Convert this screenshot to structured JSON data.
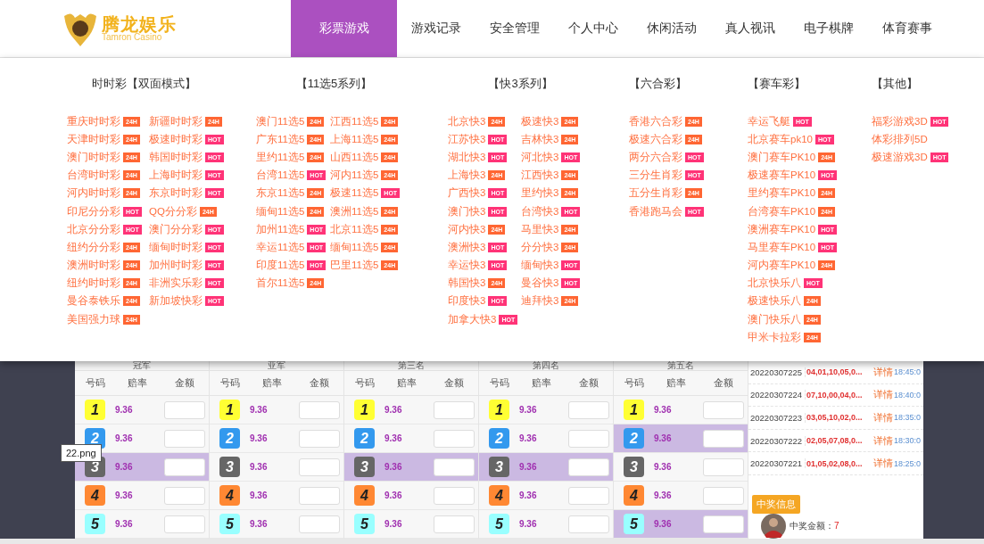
{
  "header": {
    "logo_title": "腾龙娱乐",
    "logo_subtitle": "Tamron Casino"
  },
  "nav": [
    {
      "label": "彩票游戏",
      "selected": true
    },
    {
      "label": "游戏记录",
      "selected": false
    },
    {
      "label": "安全管理",
      "selected": false
    },
    {
      "label": "个人中心",
      "selected": false
    },
    {
      "label": "休闲活动",
      "selected": false
    },
    {
      "label": "真人视讯",
      "selected": false
    },
    {
      "label": "电子棋牌",
      "selected": false
    },
    {
      "label": "体育赛事",
      "selected": false
    }
  ],
  "menu": [
    {
      "title": "时时彩【双面模式】",
      "columns": [
        [
          {
            "name": "重庆时时彩",
            "badge": "24H",
            "color": "#ff6633"
          },
          {
            "name": "天津时时彩",
            "badge": "24H",
            "color": "#ff6633"
          },
          {
            "name": "澳门时时彩",
            "badge": "24H",
            "color": "#ff6633"
          },
          {
            "name": "台湾时时彩",
            "badge": "24H",
            "color": "#ff6633"
          },
          {
            "name": "河内时时彩",
            "badge": "24H",
            "color": "#ff6633"
          },
          {
            "name": "印尼分分彩",
            "badge": "HOT",
            "color": "#ff3377"
          },
          {
            "name": "北京分分彩",
            "badge": "HOT",
            "color": "#ff3377"
          },
          {
            "name": "纽约分分彩",
            "badge": "24H",
            "color": "#ff6633"
          },
          {
            "name": "澳洲时时彩",
            "badge": "24H",
            "color": "#ff6633"
          },
          {
            "name": "纽约时时彩",
            "badge": "24H",
            "color": "#ff6633"
          },
          {
            "name": "曼谷泰铁乐",
            "badge": "24H",
            "color": "#ff6633"
          },
          {
            "name": "美国强力球",
            "badge": "24H",
            "color": "#ff6633"
          }
        ],
        [
          {
            "name": "新疆时时彩",
            "badge": "24H",
            "color": "#ff6633"
          },
          {
            "name": "极速时时彩",
            "badge": "HOT",
            "color": "#ff3377"
          },
          {
            "name": "韩国时时彩",
            "badge": "HOT",
            "color": "#ff3377"
          },
          {
            "name": "上海时时彩",
            "badge": "HOT",
            "color": "#ff3377"
          },
          {
            "name": "东京时时彩",
            "badge": "HOT",
            "color": "#ff3377"
          },
          {
            "name": "QQ分分彩",
            "badge": "24H",
            "color": "#ff6633"
          },
          {
            "name": "澳门分分彩",
            "badge": "HOT",
            "color": "#ff3377"
          },
          {
            "name": "缅甸时时彩",
            "badge": "HOT",
            "color": "#ff3377"
          },
          {
            "name": "加州时时彩",
            "badge": "HOT",
            "color": "#ff3377"
          },
          {
            "name": "非洲实乐彩",
            "badge": "HOT",
            "color": "#ff3377"
          },
          {
            "name": "新加坡快彩",
            "badge": "HOT",
            "color": "#ff3377"
          }
        ]
      ]
    },
    {
      "title": "【11选5系列】",
      "columns": [
        [
          {
            "name": "澳门11选5",
            "badge": "24H",
            "color": "#ff6633"
          },
          {
            "name": "广东11选5",
            "badge": "24H",
            "color": "#ff6633"
          },
          {
            "name": "里约11选5",
            "badge": "24H",
            "color": "#ff6633"
          },
          {
            "name": "台湾11选5",
            "badge": "HOT",
            "color": "#ff3377"
          },
          {
            "name": "东京11选5",
            "badge": "24H",
            "color": "#ff6633"
          },
          {
            "name": "缅甸11选5",
            "badge": "24H",
            "color": "#ff6633"
          },
          {
            "name": "加州11选5",
            "badge": "HOT",
            "color": "#ff3377"
          },
          {
            "name": "幸运11选5",
            "badge": "HOT",
            "color": "#ff3377"
          },
          {
            "name": "印度11选5",
            "badge": "HOT",
            "color": "#ff3377"
          },
          {
            "name": "首尔11选5",
            "badge": "24H",
            "color": "#ff6633"
          }
        ],
        [
          {
            "name": "江西11选5",
            "badge": "24H",
            "color": "#ff6633"
          },
          {
            "name": "上海11选5",
            "badge": "24H",
            "color": "#ff6633"
          },
          {
            "name": "山西11选5",
            "badge": "24H",
            "color": "#ff6633"
          },
          {
            "name": "河内11选5",
            "badge": "24H",
            "color": "#ff6633"
          },
          {
            "name": "极速11选5",
            "badge": "HOT",
            "color": "#ff3377"
          },
          {
            "name": "澳洲11选5",
            "badge": "24H",
            "color": "#ff6633"
          },
          {
            "name": "北京11选5",
            "badge": "24H",
            "color": "#ff6633"
          },
          {
            "name": "缅甸11选5",
            "badge": "24H",
            "color": "#ff6633"
          },
          {
            "name": "巴里11选5",
            "badge": "24H",
            "color": "#ff6633"
          }
        ]
      ]
    },
    {
      "title": "【快3系列】",
      "columns": [
        [
          {
            "name": "北京快3",
            "badge": "24H",
            "color": "#ff6633"
          },
          {
            "name": "江苏快3",
            "badge": "HOT",
            "color": "#ff3377"
          },
          {
            "name": "湖北快3",
            "badge": "HOT",
            "color": "#ff3377"
          },
          {
            "name": "上海快3",
            "badge": "24H",
            "color": "#ff6633"
          },
          {
            "name": "广西快3",
            "badge": "HOT",
            "color": "#ff3377"
          },
          {
            "name": "澳门快3",
            "badge": "HOT",
            "color": "#ff3377"
          },
          {
            "name": "河内快3",
            "badge": "24H",
            "color": "#ff6633"
          },
          {
            "name": "澳洲快3",
            "badge": "HOT",
            "color": "#ff3377"
          },
          {
            "name": "幸运快3",
            "badge": "HOT",
            "color": "#ff3377"
          },
          {
            "name": "韩国快3",
            "badge": "24H",
            "color": "#ff6633"
          },
          {
            "name": "印度快3",
            "badge": "HOT",
            "color": "#ff3377"
          },
          {
            "name": "加拿大快3",
            "badge": "HOT",
            "color": "#ff3377"
          }
        ],
        [
          {
            "name": "极速快3",
            "badge": "24H",
            "color": "#ff6633"
          },
          {
            "name": "吉林快3",
            "badge": "24H",
            "color": "#ff6633"
          },
          {
            "name": "河北快3",
            "badge": "HOT",
            "color": "#ff3377"
          },
          {
            "name": "江西快3",
            "badge": "24H",
            "color": "#ff6633"
          },
          {
            "name": "里约快3",
            "badge": "24H",
            "color": "#ff6633"
          },
          {
            "name": "台湾快3",
            "badge": "HOT",
            "color": "#ff3377"
          },
          {
            "name": "马里快3",
            "badge": "24H",
            "color": "#ff6633"
          },
          {
            "name": "分分快3",
            "badge": "24H",
            "color": "#ff6633"
          },
          {
            "name": "缅甸快3",
            "badge": "HOT",
            "color": "#ff3377"
          },
          {
            "name": "曼谷快3",
            "badge": "HOT",
            "color": "#ff3377"
          },
          {
            "name": "迪拜快3",
            "badge": "24H",
            "color": "#ff6633"
          }
        ]
      ]
    },
    {
      "title": "【六合彩】",
      "columns": [
        [
          {
            "name": "香港六合彩",
            "badge": "24H",
            "color": "#ff6633"
          },
          {
            "name": "极速六合彩",
            "badge": "24H",
            "color": "#ff6633"
          },
          {
            "name": "两分六合彩",
            "badge": "HOT",
            "color": "#ff3377"
          },
          {
            "name": "三分生肖彩",
            "badge": "HOT",
            "color": "#ff3377"
          },
          {
            "name": "五分生肖彩",
            "badge": "24H",
            "color": "#ff6633"
          },
          {
            "name": "香港跑马会",
            "badge": "HOT",
            "color": "#ff3377"
          }
        ]
      ]
    },
    {
      "title": "【赛车彩】",
      "columns": [
        [
          {
            "name": "幸运飞艇",
            "badge": "HOT",
            "color": "#ff3377"
          },
          {
            "name": "北京赛车pk10",
            "badge": "HOT",
            "color": "#ff3377"
          },
          {
            "name": "澳门赛车PK10",
            "badge": "24H",
            "color": "#ff6633"
          },
          {
            "name": "极速赛车PK10",
            "badge": "HOT",
            "color": "#ff3377"
          },
          {
            "name": "里约赛车PK10",
            "badge": "24H",
            "color": "#ff6633"
          },
          {
            "name": "台湾赛车PK10",
            "badge": "24H",
            "color": "#ff6633"
          },
          {
            "name": "澳洲赛车PK10",
            "badge": "HOT",
            "color": "#ff3377"
          },
          {
            "name": "马里赛车PK10",
            "badge": "HOT",
            "color": "#ff3377"
          },
          {
            "name": "河内赛车PK10",
            "badge": "24H",
            "color": "#ff6633"
          },
          {
            "name": "北京快乐八",
            "badge": "HOT",
            "color": "#ff3377"
          },
          {
            "name": "极速快乐八",
            "badge": "24H",
            "color": "#ff6633"
          },
          {
            "name": "澳门快乐八",
            "badge": "24H",
            "color": "#ff6633"
          },
          {
            "name": "甲米卡拉彩",
            "badge": "24H",
            "color": "#ff6633"
          }
        ]
      ]
    },
    {
      "title": "【其他】",
      "columns": [
        [
          {
            "name": "福彩游戏3D",
            "badge": "HOT",
            "color": "#ff3377"
          },
          {
            "name": "体彩排列5D"
          },
          {
            "name": "极速游戏3D",
            "badge": "HOT",
            "color": "#ff3377"
          }
        ]
      ]
    }
  ],
  "table": {
    "groups": [
      {
        "title": "冠军",
        "columns": [
          "号码",
          "赔率",
          "金额"
        ],
        "rows": [
          {
            "number": "1",
            "color": "#ffff33",
            "odds": "9.36",
            "selected": false
          },
          {
            "number": "2",
            "color": "#3399ee",
            "odds": "9.36",
            "selected": false
          },
          {
            "number": "3",
            "color": "#666666",
            "odds": "9.36",
            "selected": true
          },
          {
            "number": "4",
            "color": "#ff8833",
            "odds": "9.36",
            "selected": false
          },
          {
            "number": "5",
            "color": "#99ffff",
            "odds": "9.36",
            "selected": false
          }
        ]
      },
      {
        "title": "亚军",
        "columns": [
          "号码",
          "赔率",
          "金额"
        ],
        "rows": [
          {
            "number": "1",
            "color": "#ffff33",
            "odds": "9.36",
            "selected": false
          },
          {
            "number": "2",
            "color": "#3399ee",
            "odds": "9.36",
            "selected": false
          },
          {
            "number": "3",
            "color": "#666666",
            "odds": "9.36",
            "selected": false
          },
          {
            "number": "4",
            "color": "#ff8833",
            "odds": "9.36",
            "selected": false
          },
          {
            "number": "5",
            "color": "#99ffff",
            "odds": "9.36",
            "selected": false
          }
        ]
      },
      {
        "title": "第三名",
        "columns": [
          "号码",
          "赔率",
          "金额"
        ],
        "rows": [
          {
            "number": "1",
            "color": "#ffff33",
            "odds": "9.36",
            "selected": false
          },
          {
            "number": "2",
            "color": "#3399ee",
            "odds": "9.36",
            "selected": false
          },
          {
            "number": "3",
            "color": "#666666",
            "odds": "9.36",
            "selected": true
          },
          {
            "number": "4",
            "color": "#ff8833",
            "odds": "9.36",
            "selected": false
          },
          {
            "number": "5",
            "color": "#99ffff",
            "odds": "9.36",
            "selected": false
          }
        ]
      },
      {
        "title": "第四名",
        "columns": [
          "号码",
          "赔率",
          "金额"
        ],
        "rows": [
          {
            "number": "1",
            "color": "#ffff33",
            "odds": "9.36",
            "selected": false
          },
          {
            "number": "2",
            "color": "#3399ee",
            "odds": "9.36",
            "selected": false
          },
          {
            "number": "3",
            "color": "#666666",
            "odds": "9.36",
            "selected": true
          },
          {
            "number": "4",
            "color": "#ff8833",
            "odds": "9.36",
            "selected": false
          },
          {
            "number": "5",
            "color": "#99ffff",
            "odds": "9.36",
            "selected": false
          }
        ]
      },
      {
        "title": "第五名",
        "columns": [
          "号码",
          "赔率",
          "金额"
        ],
        "rows": [
          {
            "number": "1",
            "color": "#ffff33",
            "odds": "9.36",
            "selected": false
          },
          {
            "number": "2",
            "color": "#3399ee",
            "odds": "9.36",
            "selected": true
          },
          {
            "number": "3",
            "color": "#666666",
            "odds": "9.36",
            "selected": false
          },
          {
            "number": "4",
            "color": "#ff8833",
            "odds": "9.36",
            "selected": false
          },
          {
            "number": "5",
            "color": "#99ffff",
            "odds": "9.36",
            "selected": true
          }
        ]
      }
    ]
  },
  "tooltip": "22.png",
  "draws": [
    {
      "period": "20220307225",
      "numbers": "04,01,10,05,0...",
      "link": "详情",
      "time": "18:45:0"
    },
    {
      "period": "20220307224",
      "numbers": "07,10,00,04,0...",
      "link": "详情",
      "time": "18:40:0"
    },
    {
      "period": "20220307223",
      "numbers": "03,05,10,02,0...",
      "link": "详情",
      "time": "18:35:0"
    },
    {
      "period": "20220307222",
      "numbers": "02,05,07,08,0...",
      "link": "详情",
      "time": "18:30:0"
    },
    {
      "period": "20220307221",
      "numbers": "01,05,02,08,0...",
      "link": "详情",
      "time": "18:25:0"
    }
  ],
  "winners": {
    "title": "中奖信息",
    "entries": [
      {
        "amount_label": "中奖金额：",
        "amount": "7"
      }
    ]
  }
}
